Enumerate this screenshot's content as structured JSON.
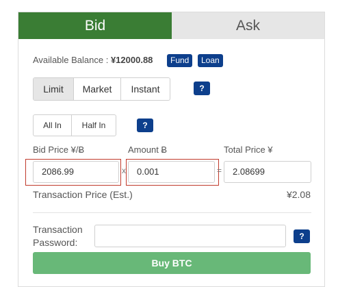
{
  "tabs": {
    "bid": "Bid",
    "ask": "Ask"
  },
  "balance": {
    "label": "Available Balance : ",
    "value": "¥12000.88",
    "fund": "Fund",
    "loan": "Loan"
  },
  "order_type": {
    "options": [
      "Limit",
      "Market",
      "Instant"
    ],
    "selected": "Limit",
    "help": "?"
  },
  "quick": {
    "options": [
      "All In",
      "Half In"
    ],
    "help": "?"
  },
  "fields": {
    "price_label": "Bid Price ¥/Ƀ",
    "amount_label": "Amount Ƀ",
    "total_label": "Total Price ¥",
    "price_value": "2086.99",
    "amount_value": "0.001",
    "total_value": "2.08699",
    "times": "x",
    "equals": "="
  },
  "estimate": {
    "label": "Transaction Price (Est.)",
    "value": "¥2.08"
  },
  "password": {
    "label_line1": "Transaction",
    "label_line2": "Password:",
    "value": "",
    "help": "?"
  },
  "submit": {
    "label": "Buy BTC"
  },
  "colors": {
    "bid_tab": "#3a7d34",
    "ask_tab": "#e6e6e6",
    "badge": "#0d3f8c",
    "buy_button": "#68b878",
    "highlight": "#c0392b"
  }
}
